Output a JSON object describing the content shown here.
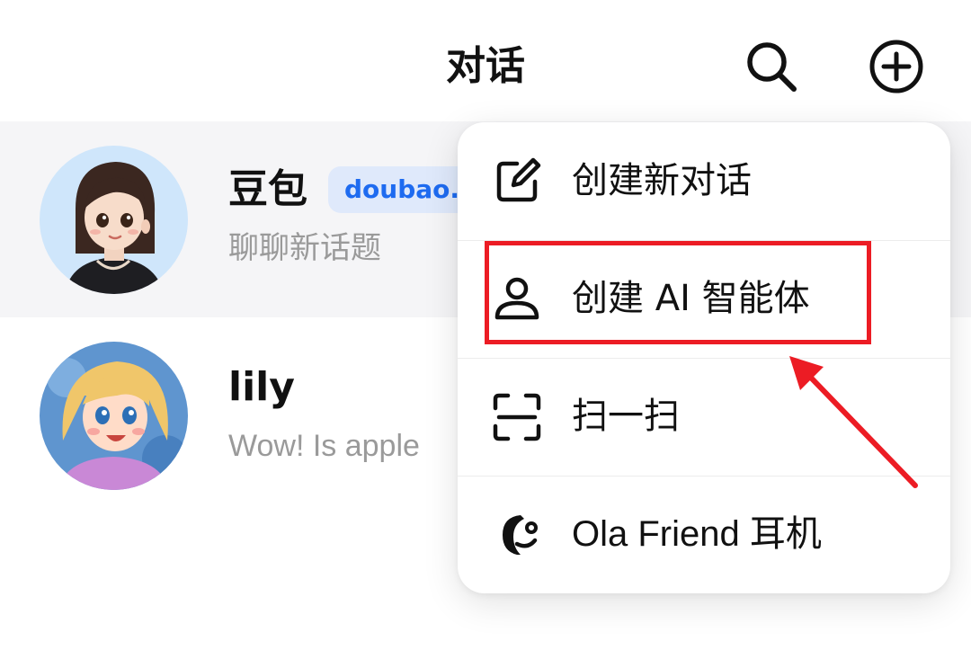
{
  "header": {
    "title": "对话",
    "search_icon": "search-icon",
    "add_icon": "plus-circle-icon"
  },
  "conversations": [
    {
      "name": "豆包",
      "badge": "doubao.c",
      "subtitle": "聊聊新话题",
      "avatar": "doubao-avatar",
      "highlighted": true
    },
    {
      "name": "lily",
      "subtitle": "Wow! Is apple",
      "avatar": "lily-avatar"
    }
  ],
  "menu": {
    "items": [
      {
        "label": "创建新对话",
        "icon": "edit-icon"
      },
      {
        "label": "创建 AI 智能体",
        "icon": "person-icon"
      },
      {
        "label": "扫一扫",
        "icon": "scan-icon"
      },
      {
        "label": "Ola Friend 耳机",
        "icon": "earphone-icon"
      }
    ]
  },
  "annotation": {
    "highlight_color": "#ec1c24",
    "highlighted_item": "创建 AI 智能体"
  },
  "colors": {
    "badge_bg": "#dfe9fb",
    "badge_text": "#1e6bf0",
    "row_highlight": "#f5f5f7"
  }
}
